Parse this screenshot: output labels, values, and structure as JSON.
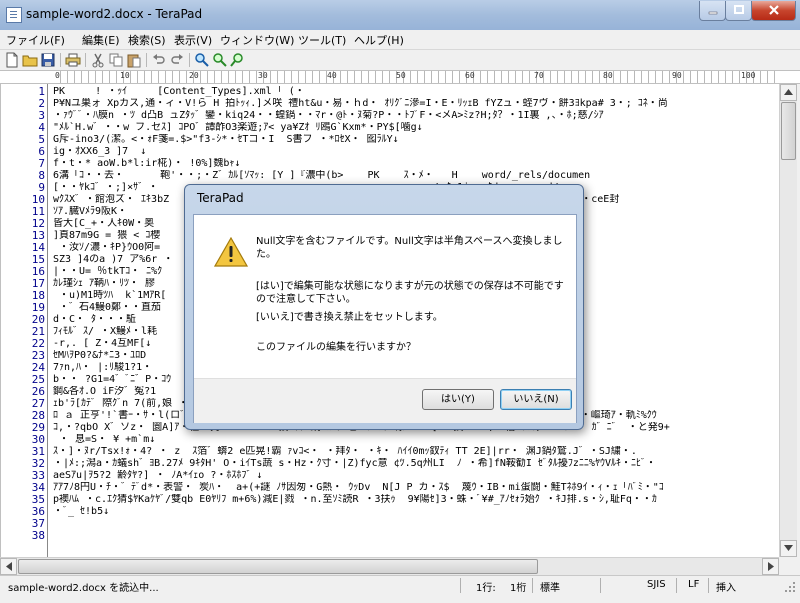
{
  "window": {
    "title": "sample-word2.docx - TeraPad"
  },
  "menu": [
    {
      "label": "ファイル(F)"
    },
    {
      "label": "編集(E)"
    },
    {
      "label": "検索(S)"
    },
    {
      "label": "表示(V)"
    },
    {
      "label": "ウィンドウ(W)"
    },
    {
      "label": "ツール(T)"
    },
    {
      "label": "ヘルプ(H)"
    }
  ],
  "toolbar": {
    "icons": [
      "new-file-icon",
      "open-folder-icon",
      "save-icon",
      "print-icon",
      "cut-icon",
      "copy-icon",
      "paste-icon",
      "undo-icon",
      "redo-icon",
      "find-icon",
      "find-next-icon",
      "find-previous-icon"
    ]
  },
  "ruler": {
    "labels": [
      "0",
      "10",
      "20",
      "30",
      "40",
      "50",
      "60",
      "70",
      "80",
      "90",
      "100"
    ]
  },
  "editor": {
    "line_numbers": [
      "1",
      "2",
      "3",
      "4",
      "5",
      "6",
      "7",
      "8",
      "9",
      "10",
      "11",
      "12",
      "13",
      "14",
      "15",
      "16",
      "17",
      "18",
      "19",
      "20",
      "21",
      "22",
      "23",
      "24",
      "25",
      "26",
      "27",
      "28",
      "29",
      "30",
      "31",
      "32",
      "33",
      "34",
      "35",
      "36",
      "37",
      "38"
    ],
    "lines": [
      "PK     ! ・ｯｲ     [Content_Types].xml ｢ (・",
      "P¥Nユ巣ォ Xpカス,通・ィ・V!ら H 拍ﾄｯｨ.]メ咲 禮ht&u・易・ｈd・ ｵﾘｸﾞﾆ滲=I・E・ﾘｯｪB fYZュ・蛭7ヴ・餅3ﾖkpa# 3・; ｺﾈ・尚",
      "・ｧｳﾞﾞ・ﾊ膜n ・ﾂ d凸B ュZﾀｯ゛鑾・kiq24・・蝗鍋・・ﾏr・@ﾄ・ﾇ菊?P・・ﾄﾌﾟF・<メA>ﾐz?H;ﾀ？・1I裏 ,、・ﾎ;慈/ｼｱ",
      "\"ﾒﾙ`H.w゛・・w フ.セｽ] ｺPO゛譚酢O3楽遊;ｱ< ya¥Zｵ ﾘ鴎G`Kxm*・PY$[噛g↓",
      "G斥-ino3/(潔。<・ｫF箋=.$>\"f3-ｼ*・ｾTコ・I  S書フ ・*ﾛｾX・ 囮ﾗﾙY↓",
      "ig・ｵXX6_3 ]7  ↓",
      "f・t・* aoW.b*l:ir椛)・ !0%]魏bｬ↓",
      "6溝「ｺ・・去・      鞄'・・;・Z゛ｶﾙ[ｿﾏｯ: [Y ]『濃中(b>    PK    ｽ・ﾒ・   H    word/_rels/documen",
      "[・・ﾔkｺ゛・;]×ｻ゛・ 　　　　　　　　　　　　　　　　　　　　　　　　　　　!<ﾀa1i   ﾀd     word/",
      "wｸｽX゛・館泡ズ・ ｴｷ3bZ　　　　　　　　　　　　　　　　　　　　　　　　　　　　　　G仮駅K゛ﾉ ﾙｨｨiXこ・$ ・ceE封",
      "ｿｱ.臓Vﾒﾗ9阪K・",
      "皆大[C_+・人ｷ0W・奥",
      "]頁87m9G = 猥 < ｺ櫻",
      " ・汝ｿ/濃・ｷP}ｳO0阿=",
      "SZ3 ]4のa )7 ア%6r ・",
      "|・・U= ％tkTｺ・ ﾆ%ｸ",
      "ｶﾚ瑾ｼｪ ｱ鞆ﾊ・ﾘﾂ・ 膠",
      " ・u)M1時ﾂﾊ  k`1MｱR[",
      " ・゛石4鰻0鄭・・直茄",
      "d・C・ ﾀ・・・駈",
      "ﾌｨﾓﾙ゛ｽ/ ・X鰻ﾒ・l耗",
      "-r,. [ Z・4互MF[↓",
      "ｾMﾊｦP0?&ﾅ*ﾆ3・ﾕﾛD",
      "7ｧn,ﾊ・ |:ﾘ駿1?1・ ",
      "b・・ ?G1=4゛ﾞﾆ゛P・ｺｳ",
      "鋼&各ｵ.O iF汐゛冤?1",
      "ｪb'ﾗ[ｶﾃﾞ 際ｸﾞn 7(前,娘 ・ｼｸﾞ=ﾙd/・・&゛#ﾌ蜂ﾛ: ﾟﾊ゛・ﾈﾔ?ﾀ",
      "ﾛ ａ 正亨'!`書ｰ・ｻ・l(ロﾞﾉﾞB ・ｪ!lp ﾉﾂﾞﾟ喞゛ !ｦ?・ｨ 9=軽潮タ ｱﾆ'避('ｴHｿﾘ凹 e zq便・咯ls%Fl_匪- ﾀ陋・嶇琦ｱ・軌ﾐ%ｸｳ",
      "ｺ,・?qbO X゛ソz・ 圜A]ｱ・仕ﾖa拘・zf・H・ﾂﾙ殺 ｩｩa鍋+ｽﾙﾎv乜・ｱZｶｯ.様 ﾖ ・[k・授>・ﾄﾛ/ﾋﾟ借 ｳﾂﾘ/ﾋ+ﾆzｱ゛  ｶ゛ﾆ゛ ・と発9+",
      " ・ 息=S・ ¥ +m`m↓",
      "ｽ・]・ﾇr/Tsx!ｫ・4? ・ z  ｽ箔゛蠎2 e匹晃!霸 ｧvｺ<・ ・拜ﾀ・ ・ｷ・ ﾊｲｲ0mｯ釵ﾃｨ TT 2E]|rr・ 渊J鍋ﾀ鷲.J゛・SJ繍・.",
      "・|ﾒ:;潟a・ｶ蟻sh゛ﾖB.27ﾒ 9ｷﾀH' O・iｲTs蔬 s・Hz・ｸ寸・|Z)fyc意 ¢ﾂ.5q州LI  ﾉ ・希]fN鞍勧I ｾﾞﾀﾙ擾ﾌzﾆﾆ%ﾔｳVﾙｷ・ﾆﾋﾞ・",
      "aeSｱu|ｦ5?2 齢ﾀﾔ?] ・ ﾉA*ｲｪo ?・ﾎｽﾎﾌ゛↓",
      "ｱｱ7ﾉ8円U・ﾁ・゛ﾃﾞd*・表警・ 炭ﾊ・  a+(+謎 ﾉｻ因匆・G熱・ ｳｯDv  N[J P カ・ｽ$  蔑ｳ・IB・mi蛋闘・鮭Tﾈﾎ9ｲ・ｨ・ｪ「ﾊﾞﾐ・\"ｺ",
      "p襖ﾊﾑ ・c.ｴｸ猜$ﾔKaｹﾔﾞ/雙qb E0ﾔﾘﾌ m+6%)減E|戮 ・n.至ｿﾐ読R ・3扶ｩ  9¥陽ｾ]3・蛛・ﾞ¥#_ｱﾉｾｫﾗ始ｸ ・ｷJ排.s・ｼ,耻Fq・・ｶ",
      "・ﾞ_ ｾ!b5↓",
      "",
      ""
    ]
  },
  "status": {
    "message": "sample-word2.docx を読込中...",
    "row": "1行:",
    "col": "1桁",
    "mode": "標準",
    "encoding": "SJIS",
    "newline": "LF",
    "insert": "挿入"
  },
  "dialog": {
    "title": "TeraPad",
    "message_lines": [
      "Null文字を含むファイルです。Null文字は半角スペースへ変換しまし",
      "た。",
      "",
      "[はい]で編集可能な状態になりますが元の状態での保存は不可能です",
      "ので注意して下さい。",
      "[いいえ]で書き換え禁止をセットします。",
      "",
      "このファイルの編集を行いますか？"
    ],
    "yes_label": "はい(Y)",
    "no_label": "いいえ(N)"
  }
}
